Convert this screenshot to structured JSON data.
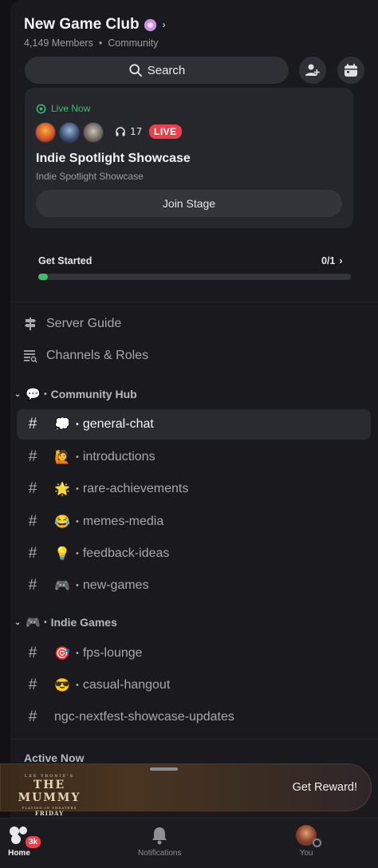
{
  "server": {
    "name": "New Game Club",
    "members": "4,149 Members",
    "separator": "•",
    "type": "Community"
  },
  "search": {
    "label": "Search"
  },
  "live": {
    "label": "Live Now",
    "listeners": "17",
    "badge": "LIVE",
    "title": "Indie Spotlight Showcase",
    "subtitle": "Indie Spotlight Showcase",
    "join_label": "Join Stage"
  },
  "get_started": {
    "label": "Get Started",
    "count": "0/1",
    "progress": 0.03
  },
  "nav": {
    "server_guide": "Server Guide",
    "channels_roles": "Channels & Roles"
  },
  "categories": [
    {
      "emoji": "💬",
      "bullet": "•",
      "name": "Community Hub"
    },
    {
      "emoji": "🎮",
      "bullet": "•",
      "name": "Indie Games"
    }
  ],
  "channels": [
    {
      "emoji": "💭",
      "bullet": "•",
      "name": "general-chat"
    },
    {
      "emoji": "🙋",
      "bullet": "•",
      "name": "introductions"
    },
    {
      "emoji": "🌟",
      "bullet": "•",
      "name": "rare-achievements"
    },
    {
      "emoji": "😂",
      "bullet": "•",
      "name": "memes-media"
    },
    {
      "emoji": "💡",
      "bullet": "•",
      "name": "feedback-ideas"
    },
    {
      "emoji": "🎮",
      "bullet": "•",
      "name": "new-games"
    },
    {
      "emoji": "🎯",
      "bullet": "•",
      "name": "fps-lounge"
    },
    {
      "emoji": "😎",
      "bullet": "•",
      "name": "casual-hangout"
    },
    {
      "name": "ngc-nextfest-showcase-updates"
    }
  ],
  "active_now": "Active Now",
  "promo": {
    "line1": "LEE YRONIE'S",
    "line2": "THE MUMMY",
    "line3": "PLAYING IN THEATERS",
    "line4": "FRIDAY",
    "cta": "Get Reward!"
  },
  "bottom_nav": {
    "home": "Home",
    "home_badge": "3k",
    "notifications": "Notifications",
    "you": "You"
  },
  "colors": {
    "accent_green": "#3cbf6a",
    "live_red": "#ec3f47",
    "panel_bg": "#1a1a1e"
  }
}
